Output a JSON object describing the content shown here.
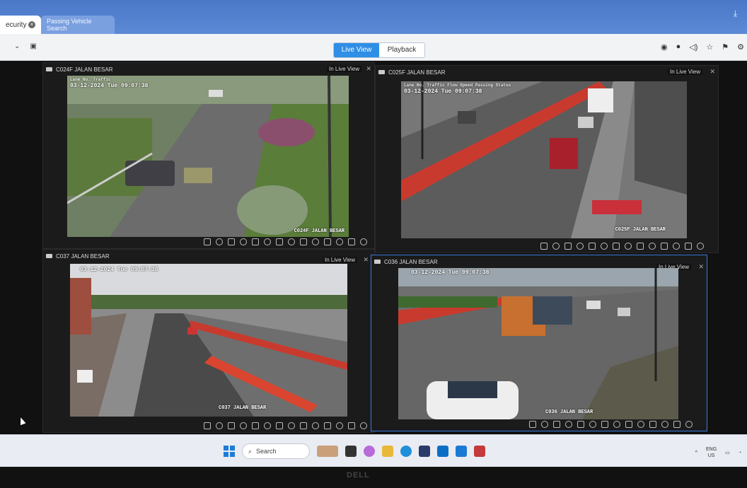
{
  "tabs": [
    {
      "label": "ecurity",
      "active": true
    },
    {
      "label": "Passing Vehicle Search",
      "active": false
    }
  ],
  "view_switch": {
    "live": "Live View",
    "playback": "Playback",
    "active": "live"
  },
  "cameras": [
    {
      "name": "C024F JALAN BESAR",
      "status": "In Live View",
      "timestamp": "03-12-2024 Tue 09:07:38",
      "info": "Lane No.  Traffic",
      "watermark": "C024F JALAN BESAR"
    },
    {
      "name": "C025F JALAN BESAR",
      "status": "In Live View",
      "timestamp": "03-12-2024 Tue 09:07:38",
      "info": "Lane No.  Traffic Flow  Speed  Passing Status",
      "watermark": "C025F JALAN BESAR"
    },
    {
      "name": "C037 JALAN BESAR",
      "status": "In Live View",
      "timestamp": "03-12-2024 Tue 09:07:38",
      "info": "",
      "watermark": "C037 JALAN BESAR"
    },
    {
      "name": "C036 JALAN BESAR",
      "status": "In Live View",
      "timestamp": "03-12-2024 Tue 09:07:38",
      "info": "",
      "watermark": "C036 JALAN BESAR"
    }
  ],
  "taskbar": {
    "search_placeholder": "Search",
    "lang_top": "ENG",
    "lang_bottom": "US"
  },
  "monitor_brand": "DELL",
  "colors": {
    "accent": "#2f8ee6",
    "selected_border": "#3b7bdc"
  }
}
